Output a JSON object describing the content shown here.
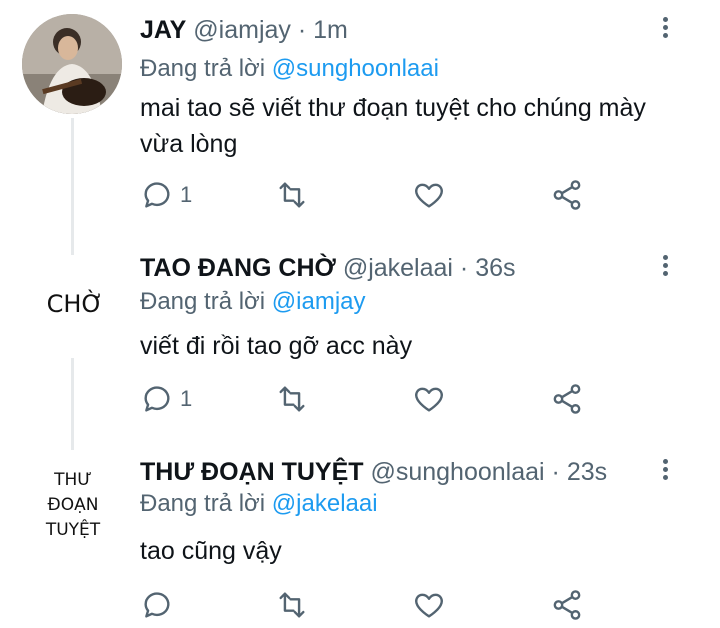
{
  "tweets": [
    {
      "avatar_text": "",
      "name": "JAY",
      "handle": "@iamjay",
      "sep": "·",
      "time": "1m",
      "reply_prefix": "Đang trả lời",
      "reply_to": "@sunghoonlaai",
      "text": "mai tao sẽ viết thư đoạn tuyệt cho chúng mày vừa lòng",
      "reply_count": "1"
    },
    {
      "avatar_text": "CHỜ",
      "name": "TAO ĐANG CHỜ",
      "handle": "@jakelaai",
      "sep": "·",
      "time": "36s",
      "reply_prefix": "Đang trả lời",
      "reply_to": "@iamjay",
      "text": "viết đi rồi tao gỡ acc này",
      "reply_count": "1"
    },
    {
      "avatar_text": "THƯ ĐOẠN TUYỆT",
      "name": "THƯ ĐOẠN TUYỆT",
      "handle": "@sunghoonlaai",
      "sep": "·",
      "time": "23s",
      "reply_prefix": "Đang trả lời",
      "reply_to": "@jakelaai",
      "text": "tao cũng vậy",
      "reply_count": ""
    }
  ],
  "icons": [
    "reply-icon",
    "retweet-icon",
    "like-icon",
    "share-icon",
    "more-options-icon"
  ],
  "colors": {
    "mention": "#1d9bf0",
    "muted": "#536471",
    "text": "#0f1419",
    "thread_line": "#e6e9eb"
  }
}
